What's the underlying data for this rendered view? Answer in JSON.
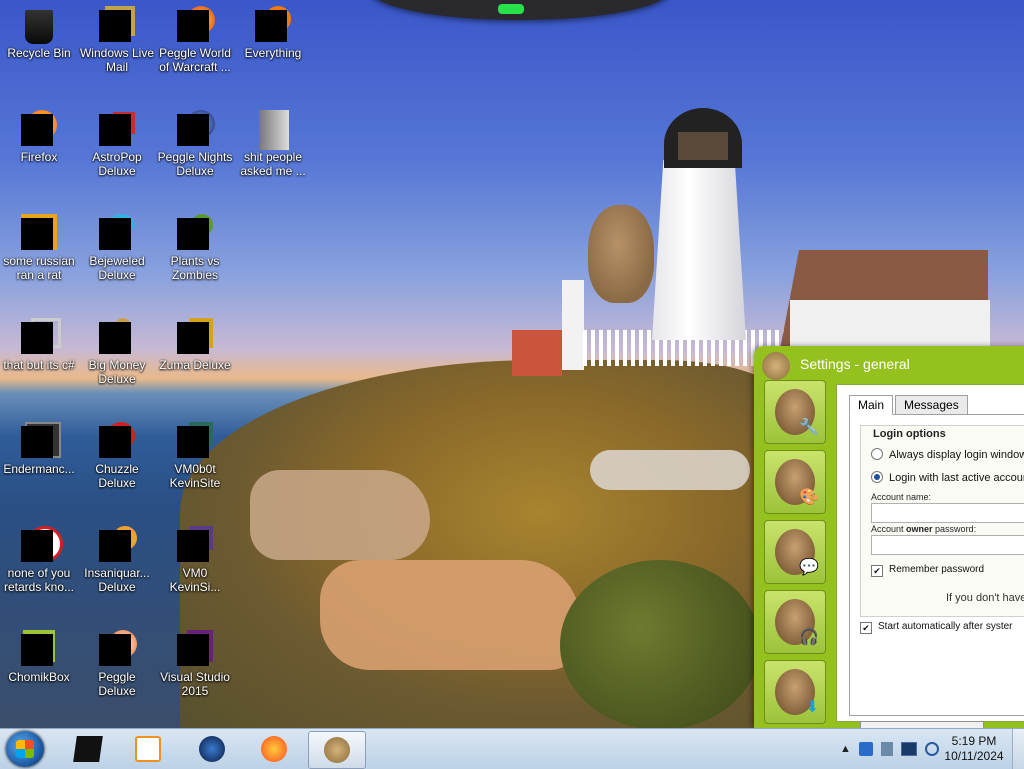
{
  "desktop": {
    "icons": [
      {
        "label": "Recycle Bin"
      },
      {
        "label": "Windows Live Mail"
      },
      {
        "label": "Peggle World of Warcraft ..."
      },
      {
        "label": "Everything"
      },
      {
        "label": "Firefox"
      },
      {
        "label": "AstroPop Deluxe"
      },
      {
        "label": "Peggle Nights Deluxe"
      },
      {
        "label": "shit people asked me ..."
      },
      {
        "label": "some russian ran a rat"
      },
      {
        "label": "Bejeweled Deluxe"
      },
      {
        "label": "Plants vs Zombies"
      },
      {
        "label": "that but its c#"
      },
      {
        "label": "Big Money Deluxe"
      },
      {
        "label": "Zuma Deluxe"
      },
      {
        "label": "Endermanc..."
      },
      {
        "label": "Chuzzle Deluxe"
      },
      {
        "label": "VM0b0t KevinSite"
      },
      {
        "label": "none of you retards kno..."
      },
      {
        "label": "Insaniquar... Deluxe"
      },
      {
        "label": "VM0 KevinSi..."
      },
      {
        "label": "ChomikBox"
      },
      {
        "label": "Peggle Deluxe"
      },
      {
        "label": "Visual Studio 2015"
      }
    ]
  },
  "window": {
    "title": "Settings - general",
    "tabs": {
      "main": "Main",
      "messages": "Messages"
    },
    "login_options_title": "Login options",
    "radio_always": "Always display login window",
    "radio_last": "Login with last active accoun",
    "account_name_label": "Account name:",
    "account_owner_password_prefix": "Account ",
    "account_owner_password_bold": "owner",
    "account_owner_password_suffix": " password:",
    "remember_password": "Remember password",
    "info_text": "If you don't have",
    "start_auto": "Start automatically after syster"
  },
  "taskbar": {
    "clock_time": "5:19 PM",
    "clock_date": "10/11/2024",
    "tray_arrow": "▲"
  }
}
